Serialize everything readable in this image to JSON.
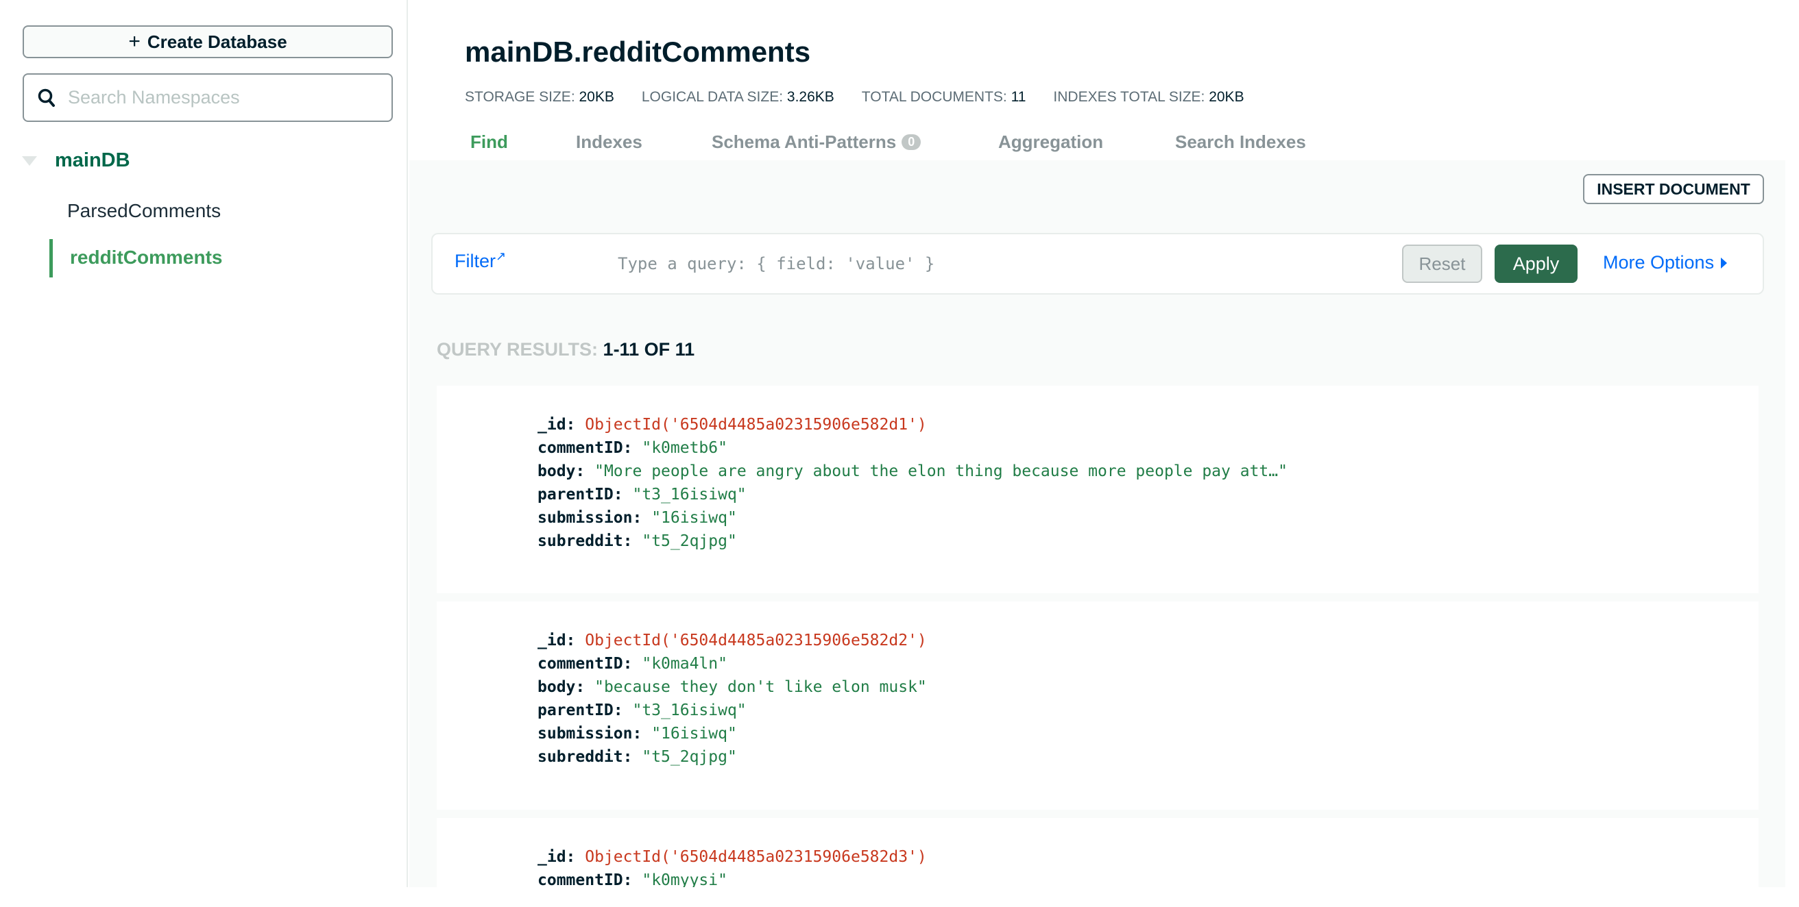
{
  "sidebar": {
    "create_label": "Create Database",
    "search_placeholder": "Search Namespaces",
    "database": "mainDB",
    "collections": [
      "ParsedComments",
      "redditComments"
    ],
    "active_collection": "redditComments"
  },
  "header": {
    "title": "mainDB.redditComments",
    "stats": [
      {
        "label": "STORAGE SIZE:",
        "value": "20KB"
      },
      {
        "label": "LOGICAL DATA SIZE:",
        "value": "3.26KB"
      },
      {
        "label": "TOTAL DOCUMENTS:",
        "value": "11"
      },
      {
        "label": "INDEXES TOTAL SIZE:",
        "value": "20KB"
      }
    ],
    "tabs": [
      "Find",
      "Indexes",
      "Schema Anti-Patterns",
      "Aggregation",
      "Search Indexes"
    ],
    "schema_badge": "0",
    "active_tab": "Find"
  },
  "toolbar": {
    "insert_label": "INSERT DOCUMENT",
    "filter_label": "Filter",
    "query_placeholder": "Type a query: { field: 'value' }",
    "query_value": "",
    "reset_label": "Reset",
    "apply_label": "Apply",
    "more_label": "More Options"
  },
  "results": {
    "label": "QUERY RESULTS:",
    "range": "1-11 OF 11",
    "documents": [
      {
        "_id": "ObjectId('6504d4485a02315906e582d1')",
        "commentID": "\"k0metb6\"",
        "body": "\"More people are angry about the elon thing because more people pay att…\"",
        "parentID": "\"t3_16isiwq\"",
        "submission": "\"16isiwq\"",
        "subreddit": "\"t5_2qjpg\""
      },
      {
        "_id": "ObjectId('6504d4485a02315906e582d2')",
        "commentID": "\"k0ma4ln\"",
        "body": "\"because they don't like elon musk\"",
        "parentID": "\"t3_16isiwq\"",
        "submission": "\"16isiwq\"",
        "subreddit": "\"t5_2qjpg\""
      },
      {
        "_id": "ObjectId('6504d4485a02315906e582d3')",
        "commentID": "\"k0myysi\""
      }
    ]
  },
  "colors": {
    "accent_green": "#00684a",
    "apply_bg": "#2c6b4c",
    "link_blue": "#016bf8",
    "objectid_red": "#c8381e",
    "string_green": "#217d47"
  }
}
